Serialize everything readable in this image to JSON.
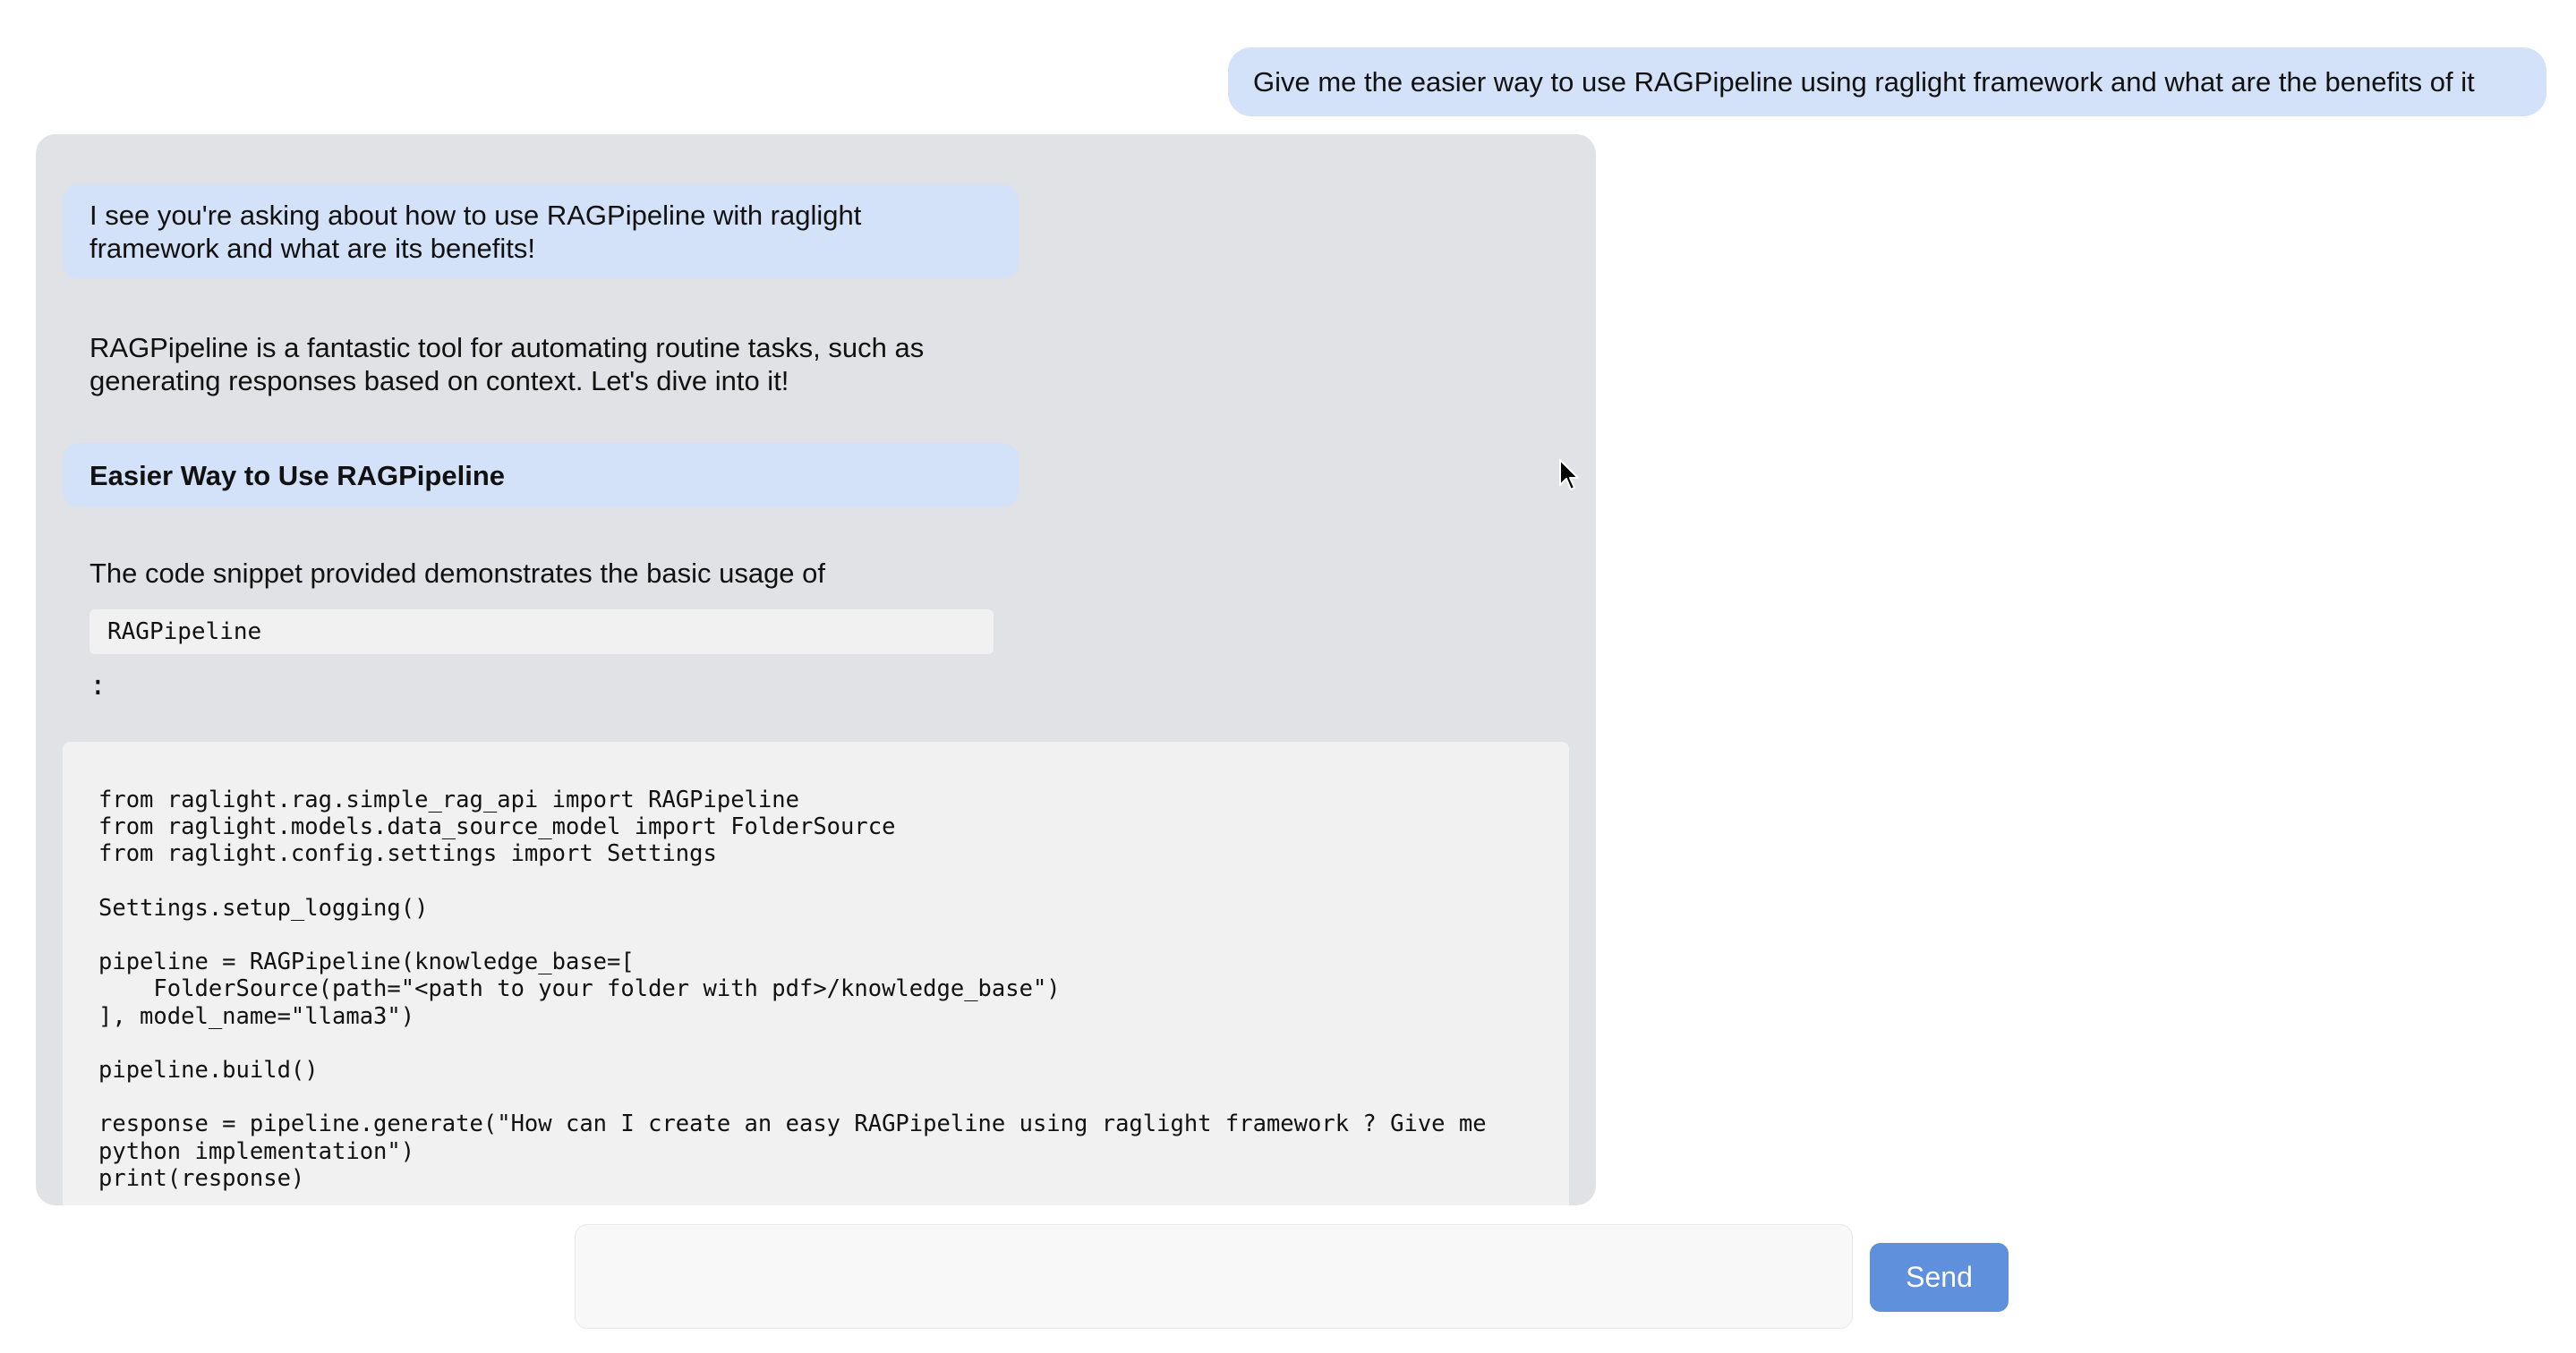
{
  "chat": {
    "user_message": "Give me the easier way to use RAGPipeline using raglight framework and what are the benefits of it",
    "bot": {
      "intro": "I see you're asking about how to use RAGPipeline with raglight framework and what are its benefits!",
      "description": "RAGPipeline is a fantastic tool for automating routine tasks, such as generating responses based on context. Let's dive into it!",
      "heading": "Easier Way to Use RAGPipeline",
      "snippet_intro": "The code snippet provided demonstrates the basic usage of",
      "inline_code": "RAGPipeline",
      "colon": ":",
      "code": "from raglight.rag.simple_rag_api import RAGPipeline\nfrom raglight.models.data_source_model import FolderSource\nfrom raglight.config.settings import Settings\n\nSettings.setup_logging()\n\npipeline = RAGPipeline(knowledge_base=[\n    FolderSource(path=\"<path to your folder with pdf>/knowledge_base\")\n], model_name=\"llama3\")\n\npipeline.build()\n\nresponse = pipeline.generate(\"How can I create an easy RAGPipeline using raglight framework ? Give me\npython implementation\")\nprint(response)"
    }
  },
  "composer": {
    "input_value": "",
    "input_placeholder": "",
    "send_label": "Send"
  },
  "colors": {
    "user_bubble": "#d3e2f9",
    "bot_panel": "#e1e2e5",
    "send_button": "#5e90dc"
  },
  "icons": {
    "cursor": "mouse-pointer-icon"
  }
}
